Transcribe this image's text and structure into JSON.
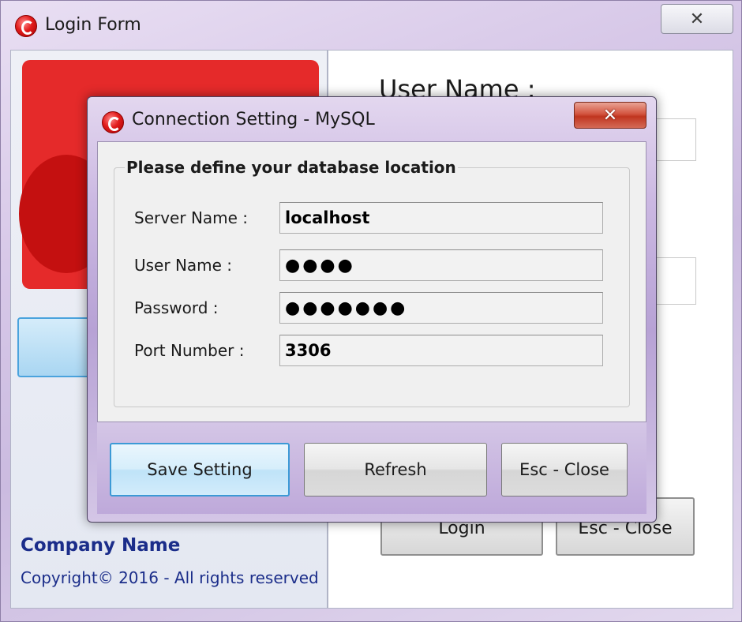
{
  "login_form": {
    "title": "Login Form",
    "username_label": "User Name :",
    "login_button": "Login",
    "close_button": "Esc - Close",
    "company_name": "Company Name",
    "copyright": "Copyright© 2016 - All rights reserved"
  },
  "dialog": {
    "title": "Connection Setting - MySQL",
    "group_title": "Please define your database location",
    "fields": {
      "server_label": "Server Name :",
      "server_value": "localhost",
      "user_label": "User Name :",
      "user_value": "●●●●",
      "password_label": "Password :",
      "password_value": "●●●●●●●",
      "port_label": "Port Number :",
      "port_value": "3306"
    },
    "buttons": {
      "save": "Save Setting",
      "refresh": "Refresh",
      "close": "Esc - Close"
    }
  },
  "icons": {
    "close": "✕",
    "app": "app-logo-icon"
  },
  "colors": {
    "brand_red": "#e52a2a",
    "company_text": "#1b2d8a",
    "focus_blue": "#3c9ad6"
  }
}
